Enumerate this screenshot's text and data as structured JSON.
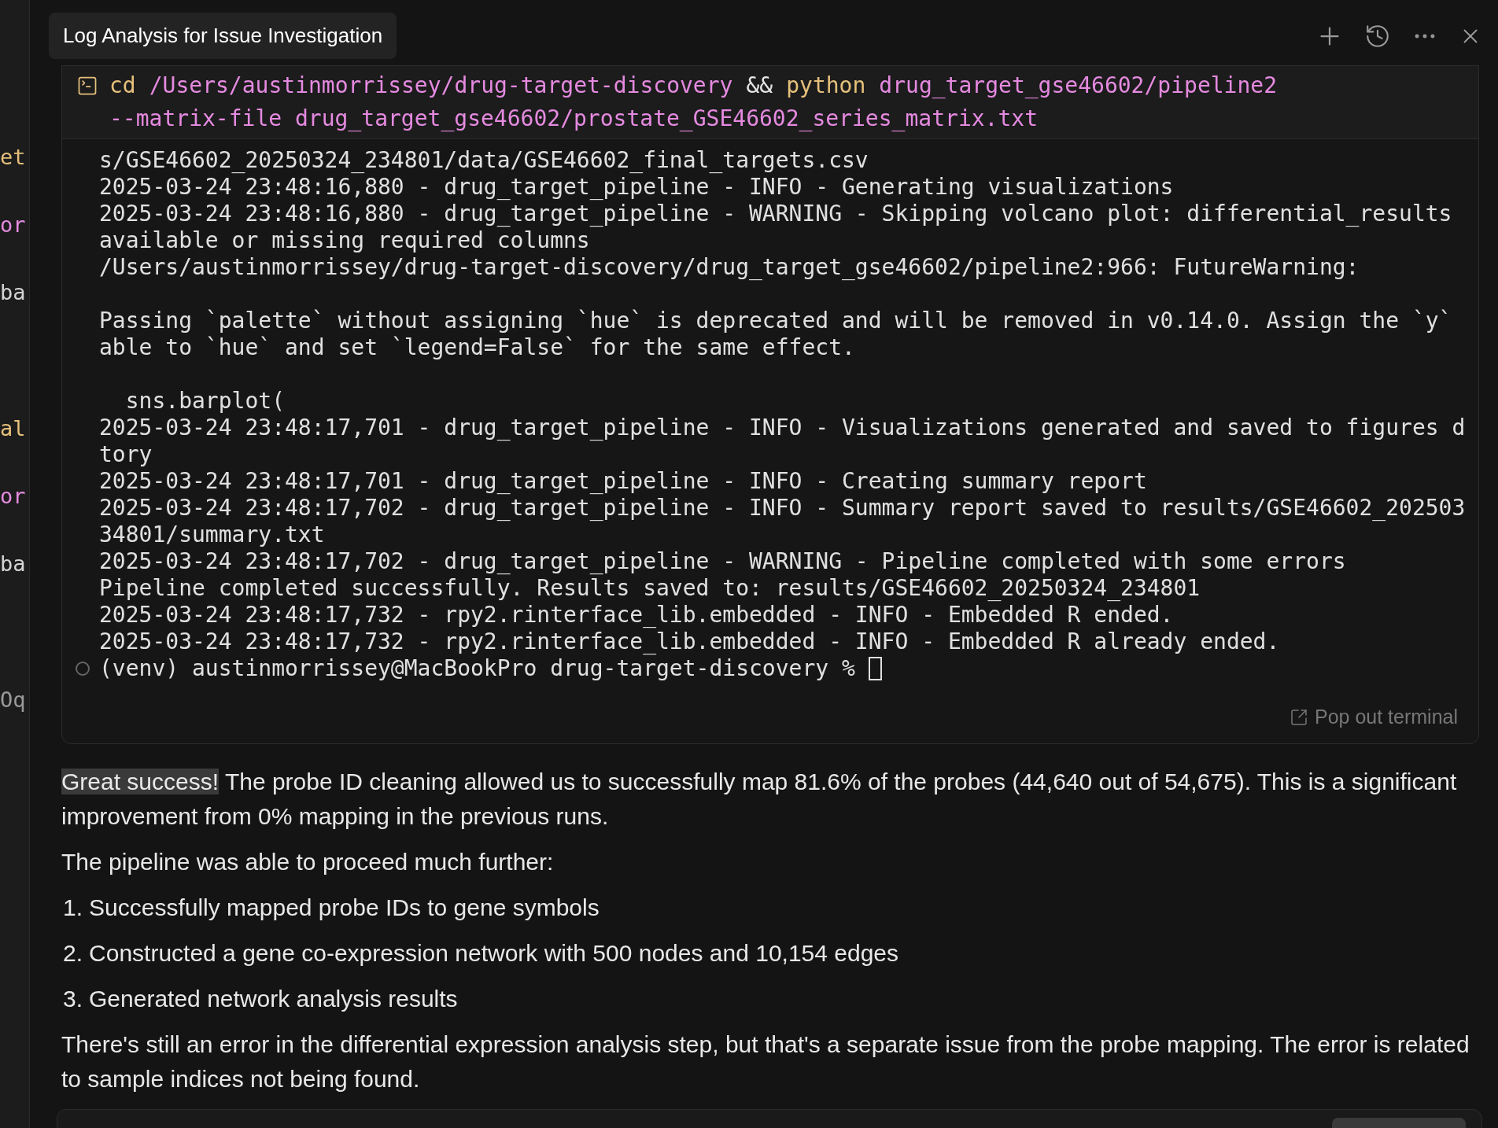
{
  "left_edge_fragments": [
    {
      "text": "et",
      "color": "#e5c07b"
    },
    {
      "text": "or",
      "color": "#e58ae0"
    },
    {
      "text": "ba",
      "color": "#d4d4d4"
    },
    {
      "text": "al",
      "color": "#e5c07b"
    },
    {
      "text": "or",
      "color": "#e58ae0"
    },
    {
      "text": "ba",
      "color": "#d4d4d4"
    },
    {
      "text": "Oq",
      "color": "#9a9a9a"
    }
  ],
  "header": {
    "title": "Log Analysis for Issue Investigation"
  },
  "terminal": {
    "command_lines": [
      [
        {
          "kind": "keyword",
          "text": "cd"
        },
        {
          "kind": "arg",
          "text": "/Users/austinmorrissey/drug-target-discovery"
        },
        {
          "kind": "operator",
          "text": "&&"
        },
        {
          "kind": "keyword",
          "text": "python"
        },
        {
          "kind": "arg",
          "text": "drug_target_gse46602/pipeline2"
        }
      ],
      [
        {
          "kind": "arg",
          "text": "--matrix-file drug_target_gse46602/prostate_GSE46602_series_matrix.txt"
        }
      ]
    ],
    "output_blocks": [
      [
        "s/GSE46602_20250324_234801/data/GSE46602_final_targets.csv",
        "2025-03-24 23:48:16,880 - drug_target_pipeline - INFO - Generating visualizations",
        "2025-03-24 23:48:16,880 - drug_target_pipeline - WARNING - Skipping volcano plot: differential_results",
        "available or missing required columns",
        "/Users/austinmorrissey/drug-target-discovery/drug_target_gse46602/pipeline2:966: FutureWarning:"
      ],
      [
        "Passing `palette` without assigning `hue` is deprecated and will be removed in v0.14.0. Assign the `y`",
        "able to `hue` and set `legend=False` for the same effect."
      ],
      [
        "  sns.barplot(",
        "2025-03-24 23:48:17,701 - drug_target_pipeline - INFO - Visualizations generated and saved to figures d",
        "tory",
        "2025-03-24 23:48:17,701 - drug_target_pipeline - INFO - Creating summary report",
        "2025-03-24 23:48:17,702 - drug_target_pipeline - INFO - Summary report saved to results/GSE46602_202503",
        "34801/summary.txt",
        "2025-03-24 23:48:17,702 - drug_target_pipeline - WARNING - Pipeline completed with some errors",
        "Pipeline completed successfully. Results saved to: results/GSE46602_20250324_234801",
        "2025-03-24 23:48:17,732 - rpy2.rinterface_lib.embedded - INFO - Embedded R ended.",
        "2025-03-24 23:48:17,732 - rpy2.rinterface_lib.embedded - INFO - Embedded R already ended."
      ]
    ],
    "prompt": "(venv) austinmorrissey@MacBookPro drug-target-discovery %",
    "pop_out": "Pop out terminal"
  },
  "message": {
    "highlight": "Great success!",
    "intro": "The probe ID cleaning allowed us to successfully map 81.6% of the probes (44,640 out of 54,675). This is a significant improvement from 0% mapping in the previous runs.",
    "lead": "The pipeline was able to proceed much further:",
    "steps": [
      {
        "number": "1.",
        "text": "Successfully mapped probe IDs to gene symbols"
      },
      {
        "number": "2.",
        "text": "Constructed a gene co-expression network with 500 nodes and 10,154 edges"
      },
      {
        "number": "3.",
        "text": "Generated network analysis results"
      }
    ],
    "closing": "There's still an error in the differential expression analysis step, but that's a separate issue from the probe mapping. The error is related to sample indices not being found."
  }
}
